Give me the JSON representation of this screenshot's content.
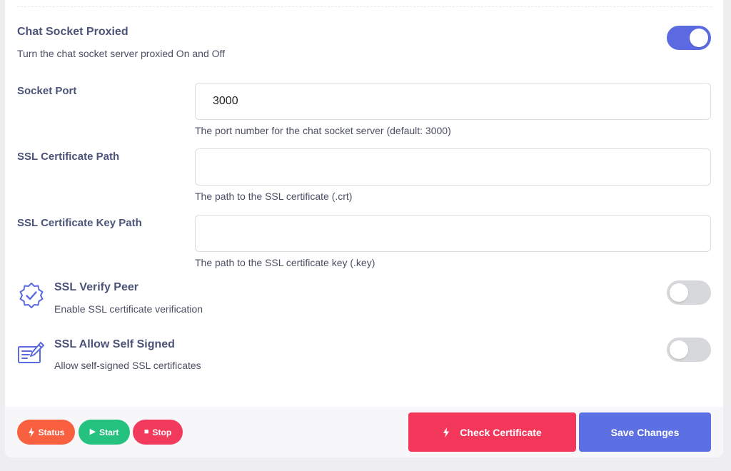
{
  "chat_socket": {
    "title": "Chat Socket Proxied",
    "description": "Turn the chat socket server proxied On and Off",
    "enabled": true
  },
  "socket_port": {
    "label": "Socket Port",
    "value": "3000",
    "hint": "The port number for the chat socket server (default: 3000)"
  },
  "ssl_cert_path": {
    "label": "SSL Certificate Path",
    "value": "",
    "hint": "The path to the SSL certificate (.crt)"
  },
  "ssl_cert_key_path": {
    "label": "SSL Certificate Key Path",
    "value": "",
    "hint": "The path to the SSL certificate key (.key)"
  },
  "ssl_verify_peer": {
    "title": "SSL Verify Peer",
    "description": "Enable SSL certificate verification",
    "icon": "badge-check-icon",
    "enabled": false
  },
  "ssl_allow_self_signed": {
    "title": "SSL Allow Self Signed",
    "description": "Allow self-signed SSL certificates",
    "icon": "certificate-sign-icon",
    "enabled": false
  },
  "footer": {
    "status_label": "Status",
    "start_label": "Start",
    "stop_label": "Stop",
    "check_certificate_label": "Check Certificate",
    "save_changes_label": "Save Changes"
  },
  "colors": {
    "accent": "#5c6ae2",
    "status": "#f9603f",
    "start": "#25c17f",
    "stop": "#f13a5c",
    "check_certificate": "#f3375a",
    "save_changes": "#5c6fe3"
  }
}
